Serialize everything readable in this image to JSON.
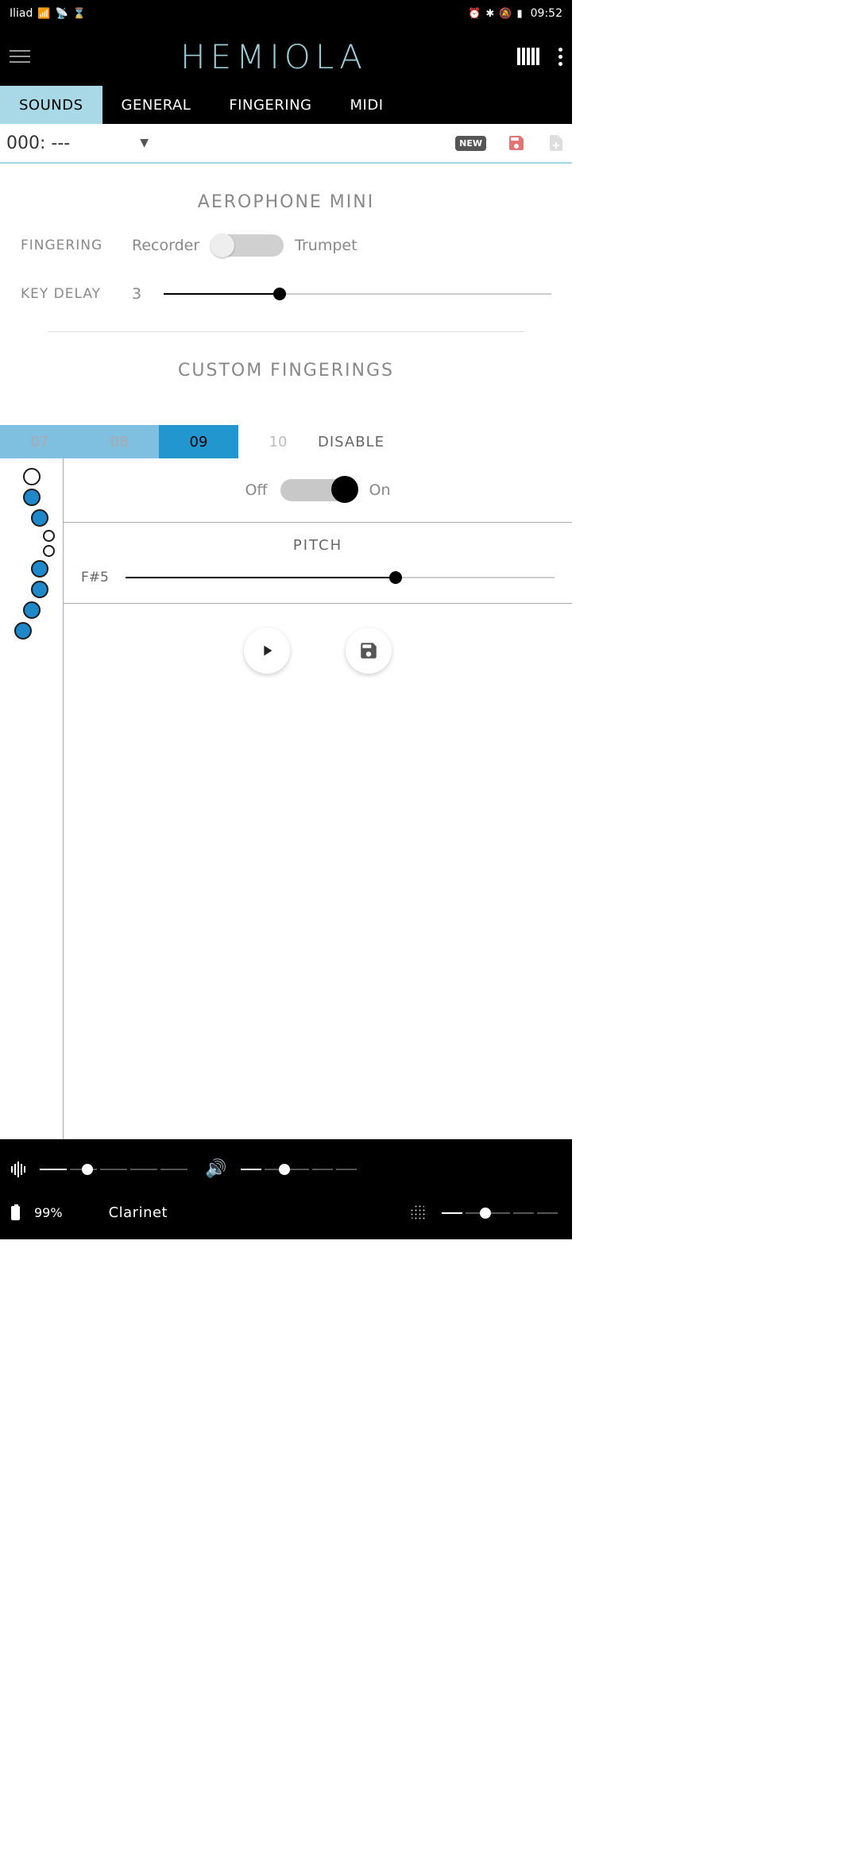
{
  "status": {
    "carrier": "Iliad",
    "alarm": "⏰",
    "bt": "✱",
    "dnd": "🔕",
    "time": "09:52"
  },
  "app": {
    "title": "HEMIOLA"
  },
  "tabs": [
    "SOUNDS",
    "GENERAL",
    "FINGERING",
    "MIDI"
  ],
  "active_tab": 0,
  "preset": {
    "label": "000: ---",
    "new_badge": "NEW"
  },
  "section1": {
    "title": "AEROPHONE MINI",
    "fingering_label": "FINGERING",
    "mode_left": "Recorder",
    "mode_right": "Trumpet",
    "keydelay_label": "KEY DELAY",
    "keydelay_value": "3",
    "keydelay_pct": 30
  },
  "section2": {
    "title": "CUSTOM FINGERINGS",
    "tabs": [
      "07",
      "08",
      "09",
      "10",
      "DISABLE"
    ],
    "active": 2,
    "toggle_off": "Off",
    "toggle_on": "On",
    "toggle_state": "on",
    "pitch_label": "PITCH",
    "pitch_value": "F#5",
    "pitch_pct": 63,
    "holes": [
      {
        "size": "lg",
        "fill": false,
        "pos": "c"
      },
      {
        "size": "lg",
        "fill": true,
        "pos": "c"
      },
      {
        "size": "lg",
        "fill": true,
        "pos": "r"
      },
      {
        "size": "sm",
        "fill": false,
        "pos": "r2"
      },
      {
        "size": "sm",
        "fill": false,
        "pos": "r2"
      },
      {
        "size": "lg",
        "fill": true,
        "pos": "r"
      },
      {
        "size": "lg",
        "fill": true,
        "pos": "r"
      },
      {
        "size": "lg",
        "fill": true,
        "pos": "c"
      },
      {
        "size": "lg",
        "fill": true,
        "pos": "l"
      }
    ]
  },
  "bottom": {
    "slider1_pct": 28,
    "slider2_pct": 32,
    "batt_pct": "99%",
    "instrument": "Clarinet",
    "slider3_pct": 32
  }
}
